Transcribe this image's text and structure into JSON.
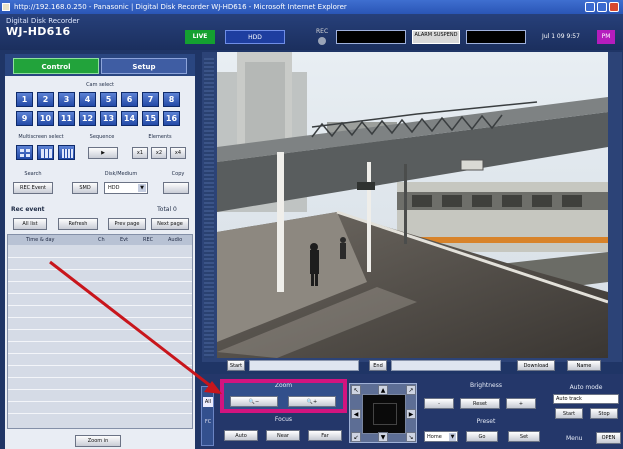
{
  "window": {
    "title": "http://192.168.0.250 - Panasonic | Digital Disk Recorder WJ-HD616 - Microsoft Internet Explorer"
  },
  "header": {
    "brand_line1": "Digital Disk Recorder",
    "brand_line2": "WJ-HD616",
    "live_label": "LIVE",
    "hdd_label": "HDD",
    "rec_label": "REC",
    "alarm_label": "ALARM SUSPEND",
    "datetime": "Jul 1 09 9:57",
    "pm_label": "PM",
    "accent_live": "#14a030",
    "accent_pm": "#b51dbd"
  },
  "tabs": {
    "control": "Control",
    "setup": "Setup"
  },
  "camera_select": {
    "label": "Cam select",
    "row1": [
      "1",
      "2",
      "3",
      "4",
      "5",
      "6",
      "7",
      "8"
    ],
    "row2": [
      "9",
      "10",
      "11",
      "12",
      "13",
      "14",
      "15",
      "16"
    ]
  },
  "multiscreen": {
    "label": "Multiscreen select",
    "sequence_label": "Sequence",
    "elements_label": "Elements",
    "x1": "x1",
    "x2": "x2",
    "x4": "x4"
  },
  "search": {
    "label": "Search",
    "ssd_label": "Disk/Medium",
    "copy_label": "Copy",
    "rec_event_btn": "REC Event",
    "smd_btn": "SMD",
    "hdd_select": "HDD"
  },
  "rec_event": {
    "title": "Rec event",
    "total_label": "Total 0",
    "all_list": "All list",
    "refresh": "Refresh",
    "prev_page": "Prev page",
    "next_page": "Next page",
    "columns": [
      "Time & day",
      "Ch",
      "Evt",
      "REC",
      "Audio"
    ]
  },
  "zoom_in_button": "Zoom in",
  "under_video": {
    "start_btn": "Start",
    "end_btn": "End",
    "download_btn": "Download",
    "name_btn": "Name"
  },
  "zoom_panel": {
    "label": "Zoom",
    "zoom_out_icon": "magnifier-minus",
    "zoom_in_icon": "magnifier-plus"
  },
  "focus_panel": {
    "label": "Focus",
    "auto": "Auto",
    "near": "Near",
    "far": "Far"
  },
  "brightness_panel": {
    "label": "Brightness",
    "minus": "-",
    "reset": "Reset",
    "plus": "+"
  },
  "preset_panel": {
    "label": "Preset",
    "home_select": "Home",
    "go": "Go",
    "set": "Set"
  },
  "auto_mode": {
    "label": "Auto mode",
    "value": "Auto track",
    "start": "Start",
    "stop": "Stop"
  },
  "menu": {
    "label": "Menu",
    "open": "OPEN"
  },
  "side_tab": {
    "all_label": "All",
    "fc_label": "FC"
  }
}
